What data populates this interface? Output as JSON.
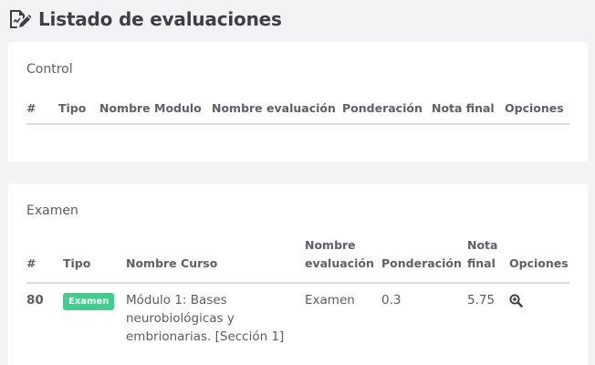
{
  "header": {
    "title": "Listado de evaluaciones",
    "icon": "edit-document-icon"
  },
  "control": {
    "title": "Control",
    "columns": [
      "#",
      "Tipo",
      "Nombre Modulo",
      "Nombre evaluación",
      "Ponderación",
      "Nota final",
      "Opciones"
    ],
    "rows": []
  },
  "exam": {
    "title": "Examen",
    "columns": [
      "#",
      "Tipo",
      "Nombre Curso",
      "Nombre evaluación",
      "Ponderación",
      "Nota final",
      "Opciones"
    ],
    "rows": [
      {
        "num": "80",
        "type_badge": "Examen",
        "course": "Módulo 1: Bases neurobiológicas y embrionarias. [Sección 1]",
        "evaluation": "Examen",
        "weight": "0.3",
        "grade": "5.75",
        "action_icon": "zoom-in-icon"
      }
    ]
  },
  "colors": {
    "badge": "#3ccf8e",
    "background": "#f2f3f5",
    "card": "#ffffff"
  }
}
